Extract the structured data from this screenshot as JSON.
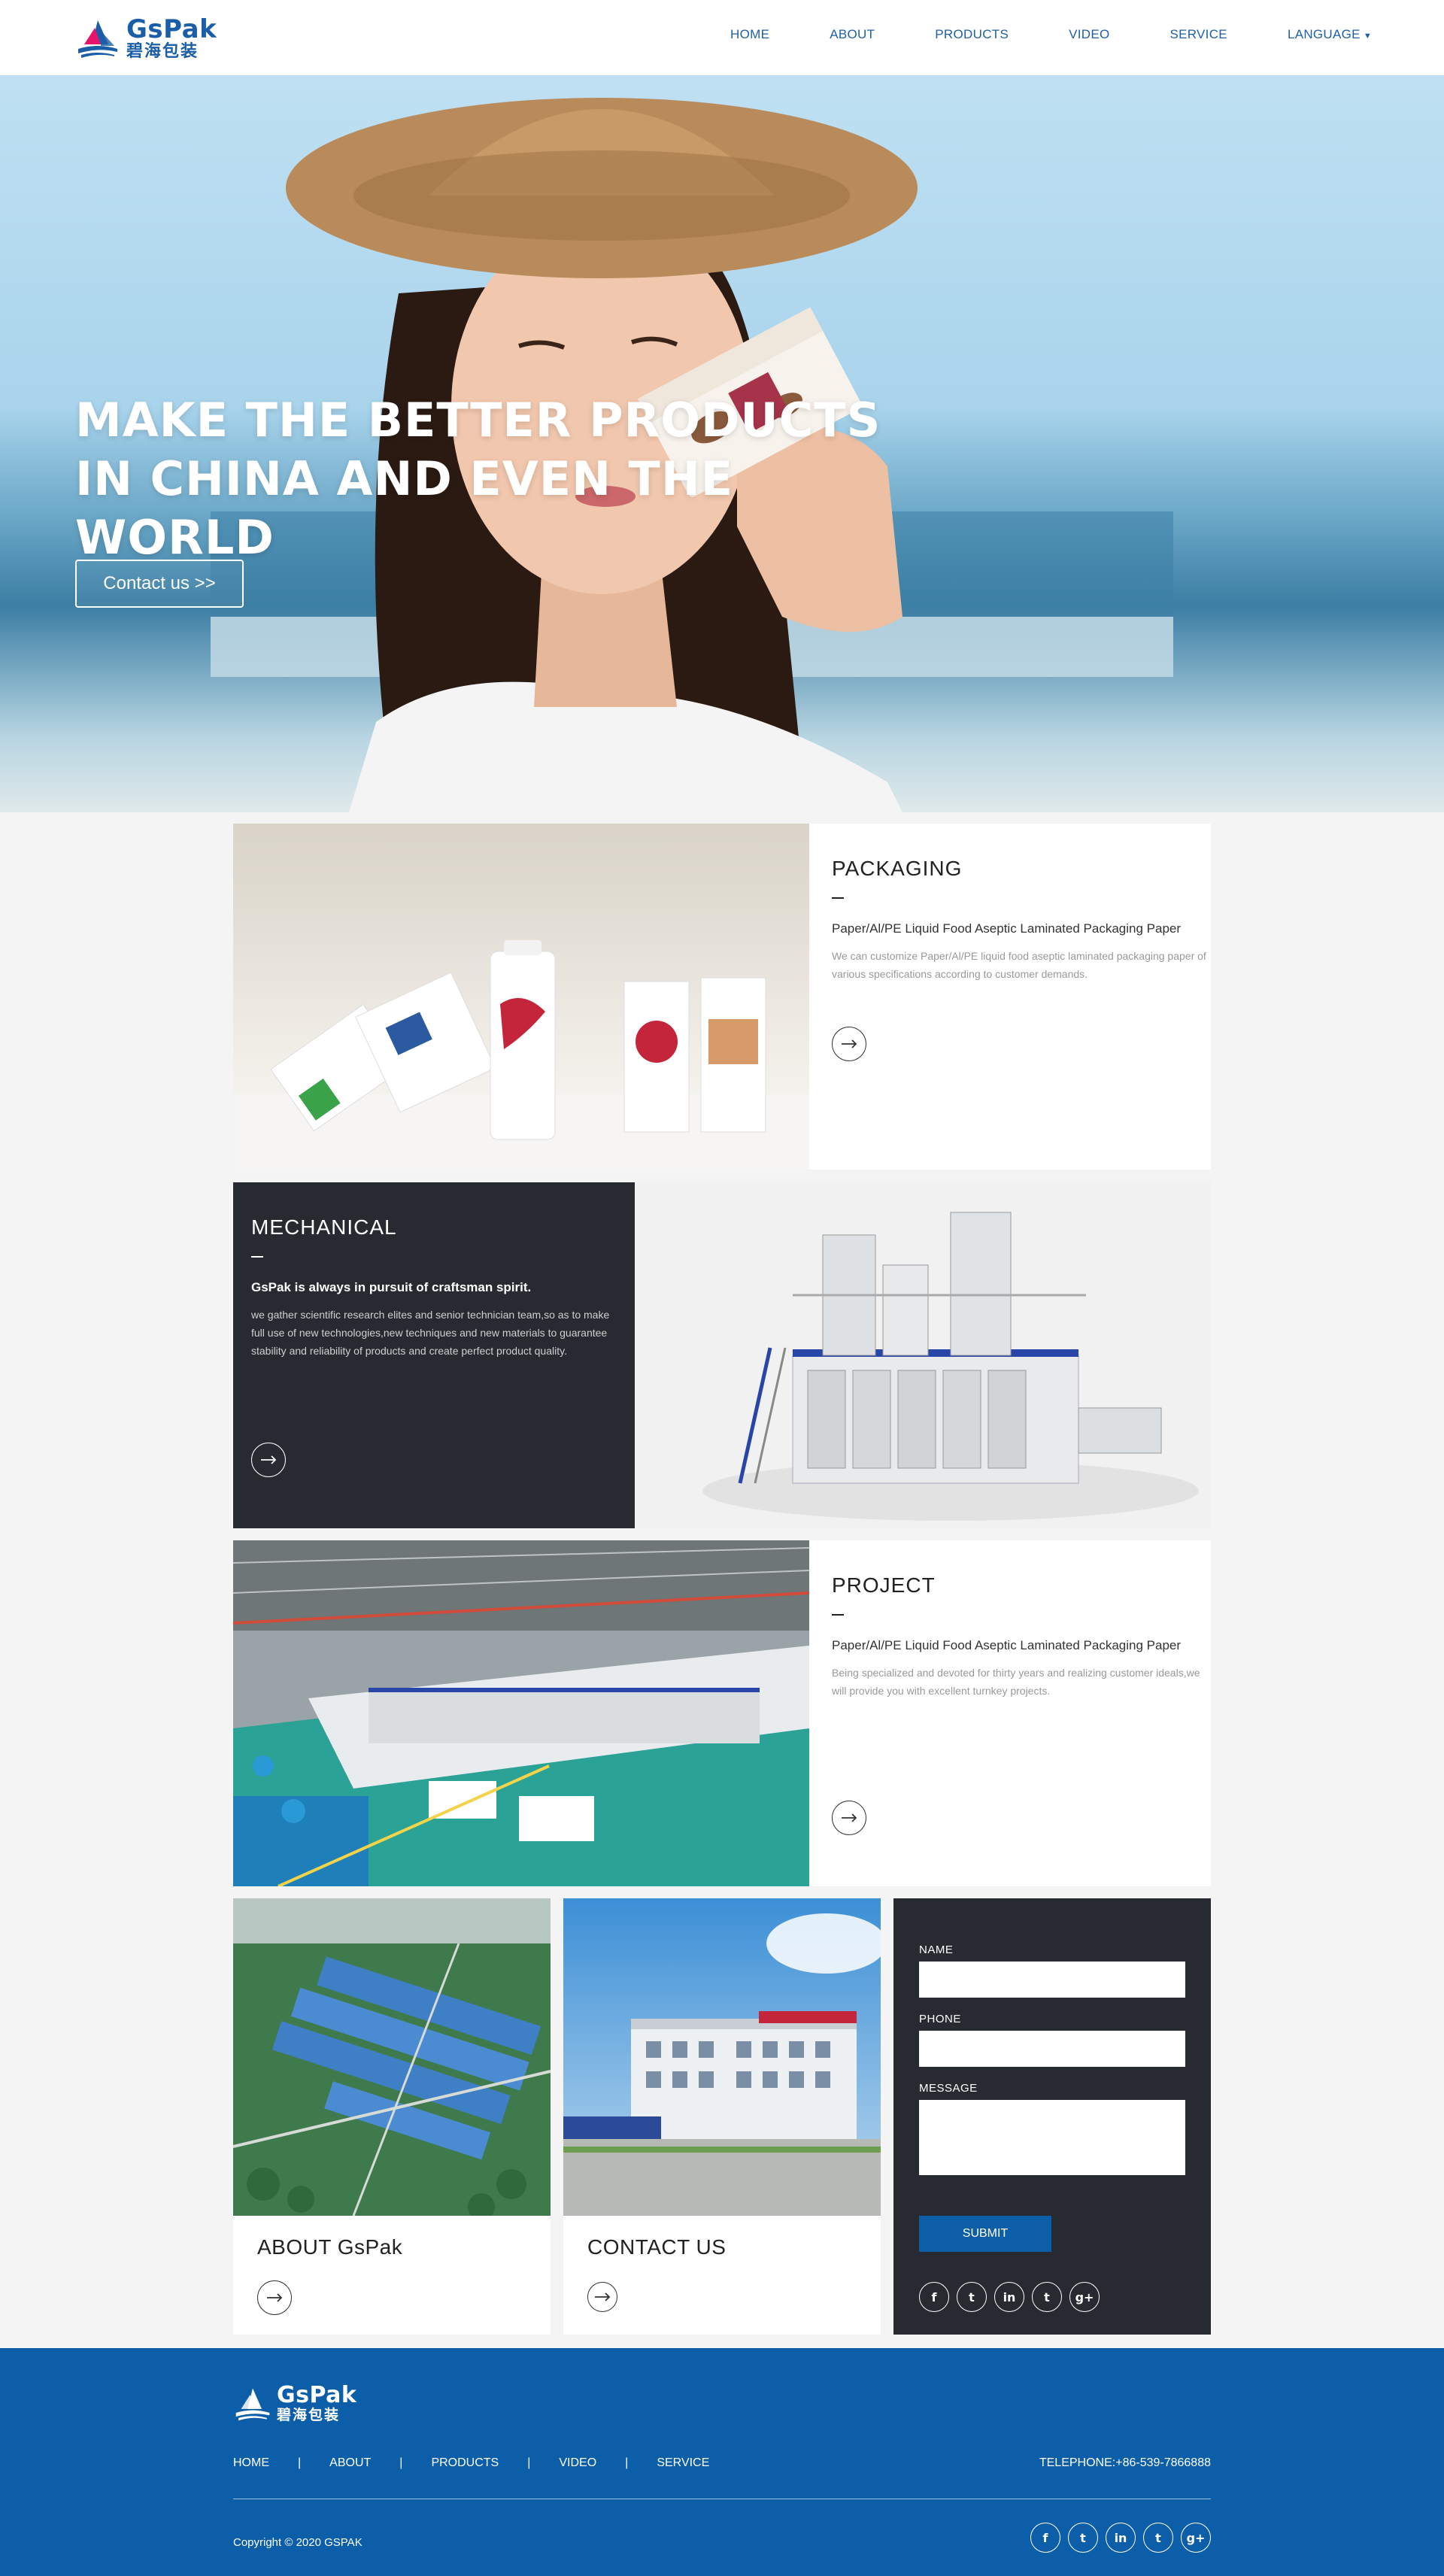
{
  "header": {
    "logo": {
      "en": "GsPak",
      "cn": "碧海包装"
    },
    "nav": [
      "HOME",
      "ABOUT",
      "PRODUCTS",
      "VIDEO",
      "SERVICE",
      "LANGUAGE"
    ]
  },
  "hero": {
    "title": "MAKE THE BETTER PRODUCTS IN CHINA AND EVEN THE WORLD",
    "button": "Contact us >>"
  },
  "sections": [
    {
      "title": "PACKAGING",
      "subtitle": "Paper/Al/PE Liquid Food Aseptic Laminated Packaging Paper",
      "desc": "We can customize Paper/Al/PE liquid food aseptic laminated packaging paper of various specifications according to customer demands."
    },
    {
      "title": "MECHANICAL",
      "subtitle": "GsPak is always in pursuit of craftsman spirit.",
      "desc": "we gather scientific research elites and senior technician team,so as to make full use of new technologies,new techniques and new materials to guarantee stability and reliability of products and create perfect product quality."
    },
    {
      "title": "PROJECT",
      "subtitle": "Paper/Al/PE Liquid Food Aseptic Laminated Packaging Paper",
      "desc": "Being specialized and devoted for thirty years and realizing customer ideals,we will provide you with excellent turnkey projects."
    }
  ],
  "cards": {
    "about": "ABOUT GsPak",
    "contact": "CONTACT US"
  },
  "form": {
    "name_label": "NAME",
    "phone_label": "PHONE",
    "message_label": "MESSAGE",
    "submit": "SUBMIT"
  },
  "social_icons": [
    "facebook-icon",
    "twitter-icon",
    "linkedin-icon",
    "tumblr-icon",
    "google-plus-icon"
  ],
  "footer": {
    "logo": {
      "en": "GsPak",
      "cn": "碧海包装"
    },
    "nav": [
      "HOME",
      "ABOUT",
      "PRODUCTS",
      "VIDEO",
      "SERVICE"
    ],
    "telephone": "TELEPHONE:+86-539-7866888",
    "copyright": "Copyright © 2020 GSPAK"
  },
  "colors": {
    "brand": "#0c5ea8",
    "dark": "#272a30",
    "nav": "#1f5fa6"
  }
}
